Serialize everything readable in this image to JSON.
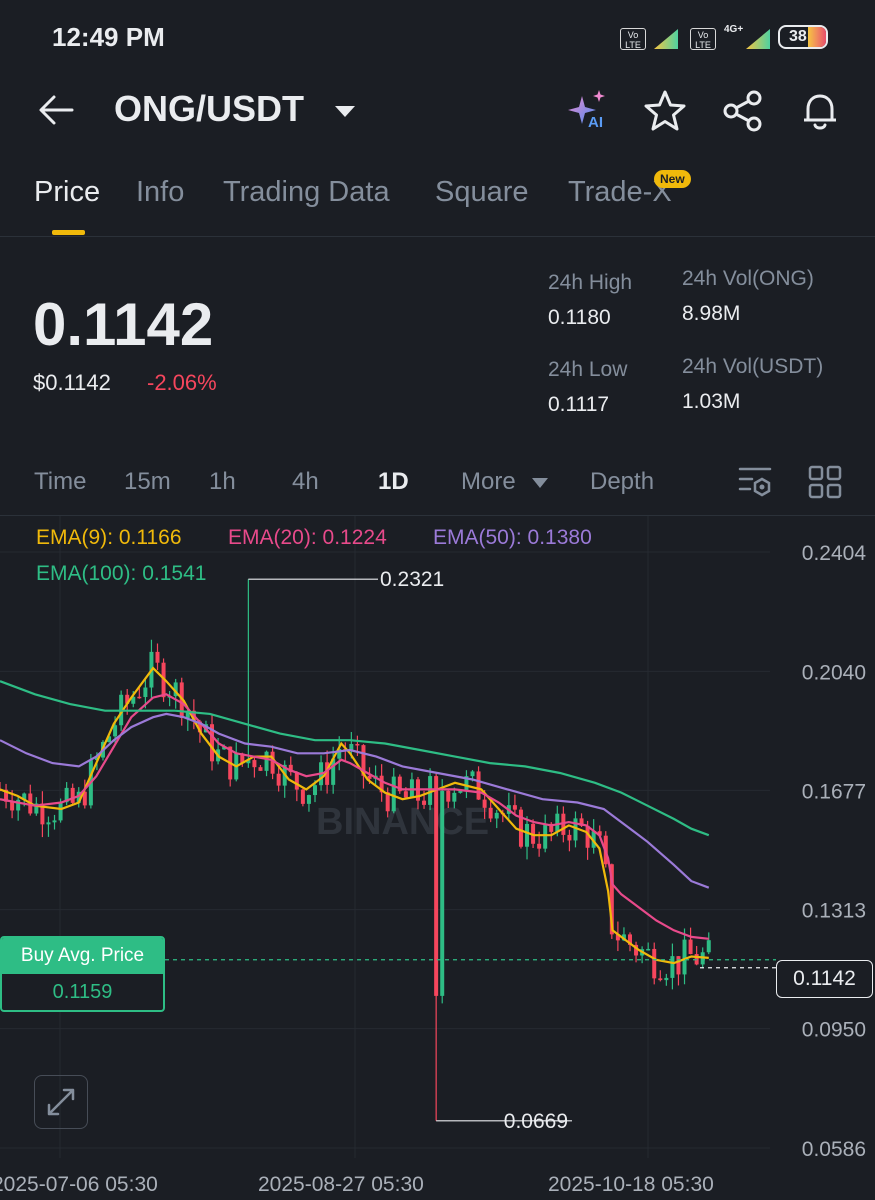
{
  "status_bar": {
    "time": "12:49 PM",
    "badges": [
      "Vo LTE",
      "Vo LTE",
      "4G+"
    ],
    "battery": "38"
  },
  "header": {
    "pair": "ONG/USDT",
    "icons": [
      "back-arrow-icon",
      "ai-sparkle-icon",
      "star-icon",
      "share-icon",
      "bell-icon"
    ],
    "ai_label": "AI"
  },
  "tabs": [
    {
      "label": "Price",
      "active": true
    },
    {
      "label": "Info",
      "active": false
    },
    {
      "label": "Trading Data",
      "active": false
    },
    {
      "label": "Square",
      "active": false
    },
    {
      "label": "Trade-X",
      "active": false,
      "badge": "New"
    }
  ],
  "price": {
    "last": "0.1142",
    "usd": "$0.1142",
    "change": "-2.06%"
  },
  "stats": {
    "high_label": "24h High",
    "high": "0.1180",
    "low_label": "24h Low",
    "low": "0.1117",
    "vol_ong_label": "24h Vol(ONG)",
    "vol_ong": "8.98M",
    "vol_usdt_label": "24h Vol(USDT)",
    "vol_usdt": "1.03M"
  },
  "intervals": [
    {
      "label": "Time",
      "active": false
    },
    {
      "label": "15m",
      "active": false
    },
    {
      "label": "1h",
      "active": false
    },
    {
      "label": "4h",
      "active": false
    },
    {
      "label": "1D",
      "active": true
    },
    {
      "label": "More",
      "active": false
    },
    {
      "label": "Depth",
      "active": false
    }
  ],
  "chart_data": {
    "type": "candlestick",
    "watermark": "BINANCE",
    "ema": [
      {
        "name": "EMA(9)",
        "value": "0.1166",
        "color": "#f0b90b"
      },
      {
        "name": "EMA(20)",
        "value": "0.1224",
        "color": "#e84a8b"
      },
      {
        "name": "EMA(50)",
        "value": "0.1380",
        "color": "#9b7ad8"
      },
      {
        "name": "EMA(100)",
        "value": "0.1541",
        "color": "#2ebd85"
      }
    ],
    "y_ticks": [
      "0.2404",
      "0.2040",
      "0.1677",
      "0.1313",
      "0.0950",
      "0.0586"
    ],
    "ylim": [
      0.0586,
      0.2404
    ],
    "x_ticks": [
      "2025-07-06 05:30",
      "2025-08-27 05:30",
      "2025-10-18 05:30"
    ],
    "high_marker": "0.2321",
    "low_marker": "0.0669",
    "current_price": "0.1142",
    "buy_avg_label": "Buy Avg. Price",
    "buy_avg_value": "0.1159",
    "colors": {
      "up": "#2ebd85",
      "down": "#f6465d"
    },
    "ema_points": {
      "ema9": [
        [
          0.0,
          0.168
        ],
        [
          0.02,
          0.166
        ],
        [
          0.04,
          0.163
        ],
        [
          0.07,
          0.162
        ],
        [
          0.09,
          0.164
        ],
        [
          0.11,
          0.176
        ],
        [
          0.13,
          0.188
        ],
        [
          0.15,
          0.196
        ],
        [
          0.175,
          0.205
        ],
        [
          0.19,
          0.201
        ],
        [
          0.21,
          0.195
        ],
        [
          0.23,
          0.185
        ],
        [
          0.25,
          0.178
        ],
        [
          0.27,
          0.175
        ],
        [
          0.29,
          0.178
        ],
        [
          0.31,
          0.178
        ],
        [
          0.33,
          0.171
        ],
        [
          0.35,
          0.168
        ],
        [
          0.37,
          0.172
        ],
        [
          0.39,
          0.182
        ],
        [
          0.4,
          0.179
        ],
        [
          0.42,
          0.171
        ],
        [
          0.44,
          0.167
        ],
        [
          0.46,
          0.165
        ],
        [
          0.48,
          0.166
        ],
        [
          0.5,
          0.168
        ],
        [
          0.52,
          0.17
        ],
        [
          0.55,
          0.168
        ],
        [
          0.57,
          0.162
        ],
        [
          0.59,
          0.156
        ],
        [
          0.61,
          0.154
        ],
        [
          0.63,
          0.154
        ],
        [
          0.65,
          0.157
        ],
        [
          0.67,
          0.155
        ],
        [
          0.685,
          0.15
        ],
        [
          0.695,
          0.137
        ],
        [
          0.7,
          0.125
        ],
        [
          0.71,
          0.123
        ],
        [
          0.73,
          0.119
        ],
        [
          0.75,
          0.116
        ],
        [
          0.77,
          0.115
        ],
        [
          0.79,
          0.117
        ],
        [
          0.81,
          0.1166
        ]
      ],
      "ema20": [
        [
          0.0,
          0.165
        ],
        [
          0.02,
          0.164
        ],
        [
          0.04,
          0.163
        ],
        [
          0.07,
          0.164
        ],
        [
          0.09,
          0.166
        ],
        [
          0.11,
          0.172
        ],
        [
          0.13,
          0.181
        ],
        [
          0.15,
          0.19
        ],
        [
          0.175,
          0.196
        ],
        [
          0.19,
          0.197
        ],
        [
          0.21,
          0.194
        ],
        [
          0.23,
          0.188
        ],
        [
          0.25,
          0.182
        ],
        [
          0.27,
          0.179
        ],
        [
          0.29,
          0.178
        ],
        [
          0.31,
          0.177
        ],
        [
          0.33,
          0.174
        ],
        [
          0.35,
          0.172
        ],
        [
          0.37,
          0.173
        ],
        [
          0.39,
          0.177
        ],
        [
          0.4,
          0.176
        ],
        [
          0.42,
          0.173
        ],
        [
          0.44,
          0.17
        ],
        [
          0.46,
          0.168
        ],
        [
          0.48,
          0.168
        ],
        [
          0.5,
          0.168
        ],
        [
          0.52,
          0.168
        ],
        [
          0.55,
          0.167
        ],
        [
          0.57,
          0.164
        ],
        [
          0.59,
          0.16
        ],
        [
          0.61,
          0.158
        ],
        [
          0.63,
          0.157
        ],
        [
          0.65,
          0.158
        ],
        [
          0.67,
          0.157
        ],
        [
          0.685,
          0.154
        ],
        [
          0.695,
          0.147
        ],
        [
          0.7,
          0.139
        ],
        [
          0.71,
          0.136
        ],
        [
          0.73,
          0.132
        ],
        [
          0.75,
          0.128
        ],
        [
          0.77,
          0.125
        ],
        [
          0.79,
          0.123
        ],
        [
          0.81,
          0.1224
        ]
      ],
      "ema50": [
        [
          0.0,
          0.183
        ],
        [
          0.03,
          0.179
        ],
        [
          0.06,
          0.176
        ],
        [
          0.09,
          0.175
        ],
        [
          0.11,
          0.178
        ],
        [
          0.13,
          0.183
        ],
        [
          0.15,
          0.187
        ],
        [
          0.175,
          0.19
        ],
        [
          0.19,
          0.191
        ],
        [
          0.21,
          0.19
        ],
        [
          0.23,
          0.188
        ],
        [
          0.25,
          0.185
        ],
        [
          0.28,
          0.182
        ],
        [
          0.31,
          0.181
        ],
        [
          0.34,
          0.179
        ],
        [
          0.37,
          0.179
        ],
        [
          0.4,
          0.18
        ],
        [
          0.43,
          0.178
        ],
        [
          0.46,
          0.175
        ],
        [
          0.5,
          0.173
        ],
        [
          0.54,
          0.171
        ],
        [
          0.58,
          0.168
        ],
        [
          0.62,
          0.165
        ],
        [
          0.66,
          0.164
        ],
        [
          0.69,
          0.162
        ],
        [
          0.71,
          0.158
        ],
        [
          0.74,
          0.152
        ],
        [
          0.77,
          0.145
        ],
        [
          0.79,
          0.14
        ],
        [
          0.81,
          0.138
        ]
      ],
      "ema100": [
        [
          0.0,
          0.201
        ],
        [
          0.04,
          0.197
        ],
        [
          0.08,
          0.194
        ],
        [
          0.12,
          0.192
        ],
        [
          0.16,
          0.192
        ],
        [
          0.2,
          0.192
        ],
        [
          0.24,
          0.191
        ],
        [
          0.28,
          0.188
        ],
        [
          0.32,
          0.185
        ],
        [
          0.36,
          0.183
        ],
        [
          0.4,
          0.183
        ],
        [
          0.44,
          0.182
        ],
        [
          0.48,
          0.18
        ],
        [
          0.52,
          0.178
        ],
        [
          0.56,
          0.176
        ],
        [
          0.6,
          0.175
        ],
        [
          0.64,
          0.173
        ],
        [
          0.68,
          0.17
        ],
        [
          0.71,
          0.167
        ],
        [
          0.74,
          0.163
        ],
        [
          0.77,
          0.159
        ],
        [
          0.79,
          0.156
        ],
        [
          0.81,
          0.154
        ]
      ]
    }
  }
}
